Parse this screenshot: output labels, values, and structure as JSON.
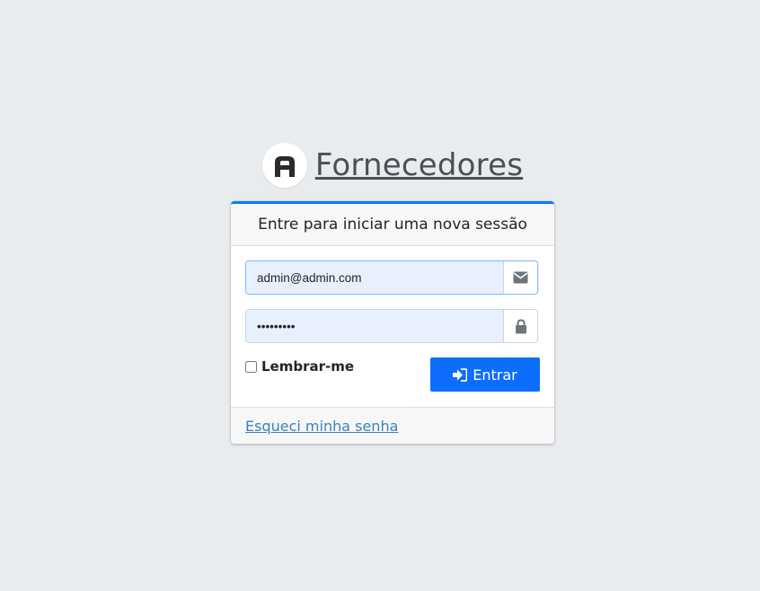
{
  "brand": {
    "logo_letter": "A",
    "title": "Fornecedores"
  },
  "login": {
    "header": "Entre para iniciar uma nova sessão",
    "email": {
      "value": "admin@admin.com",
      "icon": "envelope-icon"
    },
    "password": {
      "value": "•••••••••",
      "icon": "lock-icon"
    },
    "remember_label": "Lembrar-me",
    "remember_checked": false,
    "submit_label": "Entrar",
    "submit_icon": "sign-in-icon",
    "forgot_label": "Esqueci minha senha"
  },
  "colors": {
    "background": "#e9ecef",
    "accent": "#007bff",
    "button": "#0d6efd",
    "link": "#3b82c4"
  }
}
